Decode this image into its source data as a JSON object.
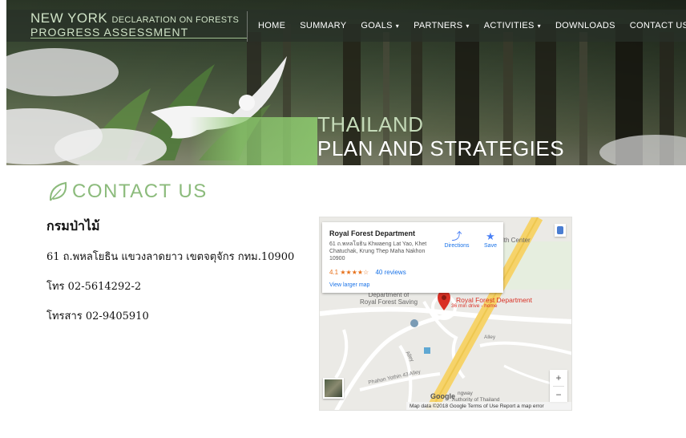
{
  "header": {
    "logo_line1": "NEW YORK",
    "logo_line1_sub": "DECLARATION ON FORESTS",
    "logo_line2": "PROGRESS ASSESSMENT",
    "nav": [
      {
        "label": "HOME",
        "dropdown": false
      },
      {
        "label": "SUMMARY",
        "dropdown": false
      },
      {
        "label": "GOALS",
        "dropdown": true
      },
      {
        "label": "PARTNERS",
        "dropdown": true
      },
      {
        "label": "ACTIVITIES",
        "dropdown": true
      },
      {
        "label": "DOWNLOADS",
        "dropdown": false
      },
      {
        "label": "CONTACT US",
        "dropdown": false
      }
    ]
  },
  "hero": {
    "title_line1": "THAILAND",
    "title_line2": "PLAN AND STRATEGIES"
  },
  "section": {
    "title": "CONTACT US"
  },
  "contact": {
    "org_name": "กรมป่าไม้",
    "address": "61 ถ.พหลโยธิน แขวงลาดยาว เขตจตุจักร กทม.10900",
    "phone": "โทร 02-5614292-2",
    "fax": "โทรสาร 02-9405910"
  },
  "map": {
    "card_name": "Royal Forest Department",
    "card_address": "61 ถ.พหลโยธิน Khwaeng Lat Yao, Khet Chatuchak, Krung Thep Maha Nakhon 10900",
    "rating": "4.1",
    "stars": "★★★★☆",
    "reviews": "40 reviews",
    "larger_map": "View larger map",
    "directions": "Directions",
    "save": "Save",
    "pin_label": "Royal Forest Department",
    "pin_sub": "36 min drive - home",
    "dept_label_1": "Department of",
    "dept_label_2": "Royal Forest Saving",
    "label_health": "lth Center",
    "label_alley": "Alley",
    "label_alley2": "Alley",
    "label_road": "Phahon Yothin 43 Alley",
    "label_way": "ngway",
    "label_auth": "Authority of Thailand",
    "google": "Google",
    "zoom_in": "+",
    "zoom_out": "−",
    "footer": "Map data ©2018 Google   Terms of Use   Report a map error"
  },
  "colors": {
    "accent_green": "#8cbb7c",
    "nav_bg": "#283028",
    "pin_red": "#d93025",
    "link_blue": "#1a73e8"
  }
}
